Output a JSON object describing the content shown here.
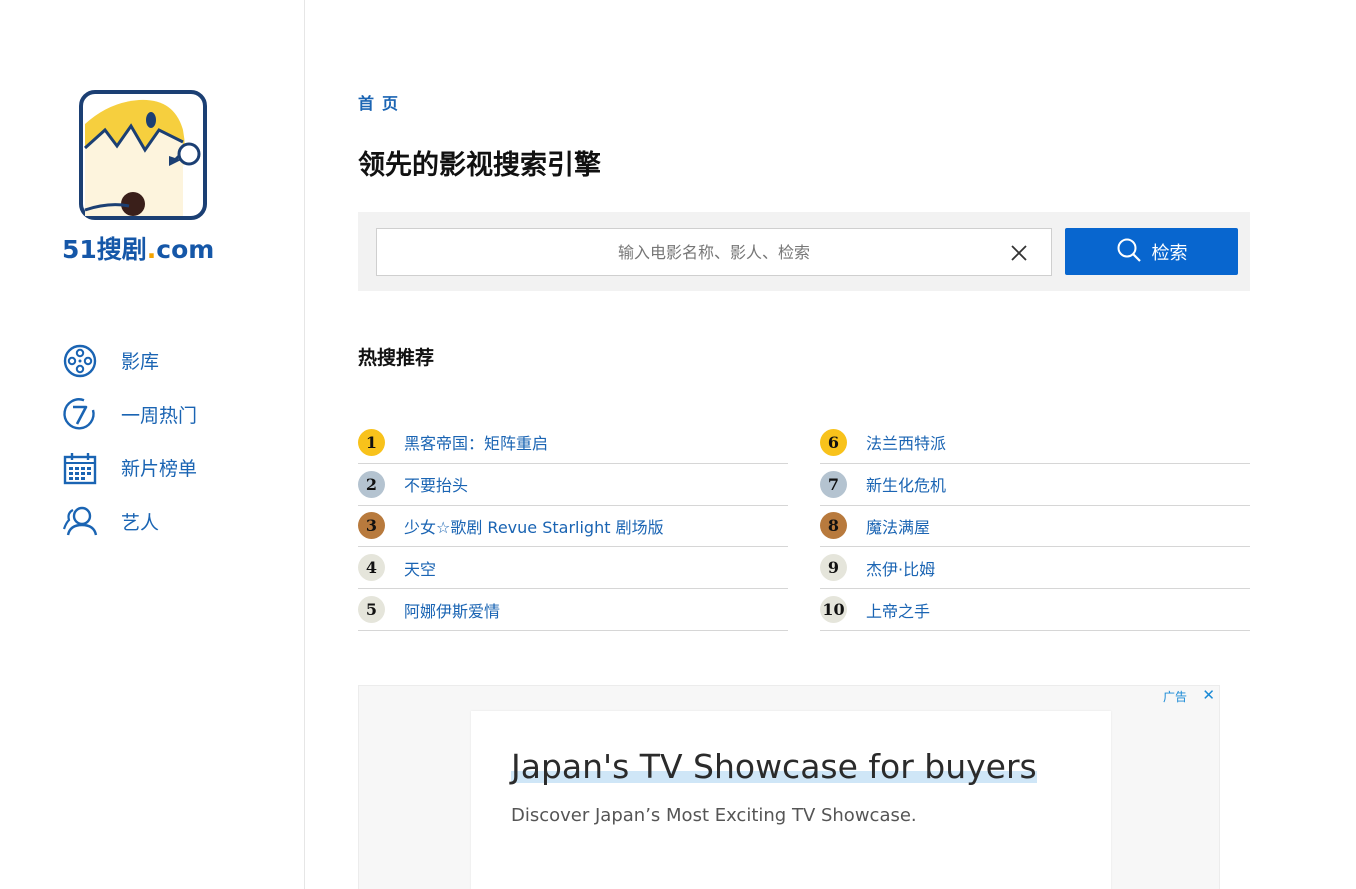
{
  "brand": {
    "logo_text": "51搜剧",
    "logo_dot": ".",
    "logo_suffix": "com"
  },
  "sidebar": {
    "items": [
      {
        "label": "影库",
        "icon": "film-reel-icon"
      },
      {
        "label": "一周热门",
        "icon": "seven-day-icon"
      },
      {
        "label": "新片榜单",
        "icon": "calendar-icon"
      },
      {
        "label": "艺人",
        "icon": "people-icon"
      }
    ]
  },
  "breadcrumb": "首页",
  "page_title": "领先的影视搜索引擎",
  "search": {
    "placeholder": "输入电影名称、影人、检索",
    "value": "",
    "button_label": "检索"
  },
  "hot": {
    "title": "热搜推荐",
    "left": [
      {
        "rank": "1",
        "title": "黑客帝国：矩阵重启",
        "medal": "gold"
      },
      {
        "rank": "2",
        "title": "不要抬头",
        "medal": "silver"
      },
      {
        "rank": "3",
        "title": "少女☆歌剧 Revue Starlight 剧场版",
        "medal": "bronze"
      },
      {
        "rank": "4",
        "title": "天空",
        "medal": "plain"
      },
      {
        "rank": "5",
        "title": "阿娜伊斯爱情",
        "medal": "plain"
      }
    ],
    "right": [
      {
        "rank": "6",
        "title": "法兰西特派",
        "medal": "gold"
      },
      {
        "rank": "7",
        "title": "新生化危机",
        "medal": "silver"
      },
      {
        "rank": "8",
        "title": "魔法满屋",
        "medal": "bronze"
      },
      {
        "rank": "9",
        "title": "杰伊·比姆",
        "medal": "plain"
      },
      {
        "rank": "10",
        "title": "上帝之手",
        "medal": "plain"
      }
    ]
  },
  "ad": {
    "label": "广告",
    "close": "✕",
    "headline": "Japan's TV Showcase for buyers",
    "description": "Discover Japan’s Most Exciting TV Showcase."
  },
  "colors": {
    "accent": "#1a64b3",
    "button": "#0866cf",
    "gold": "#f8c21b",
    "silver": "#b4c3d0",
    "bronze": "#b87a3d",
    "plain": "#e5e5db"
  }
}
